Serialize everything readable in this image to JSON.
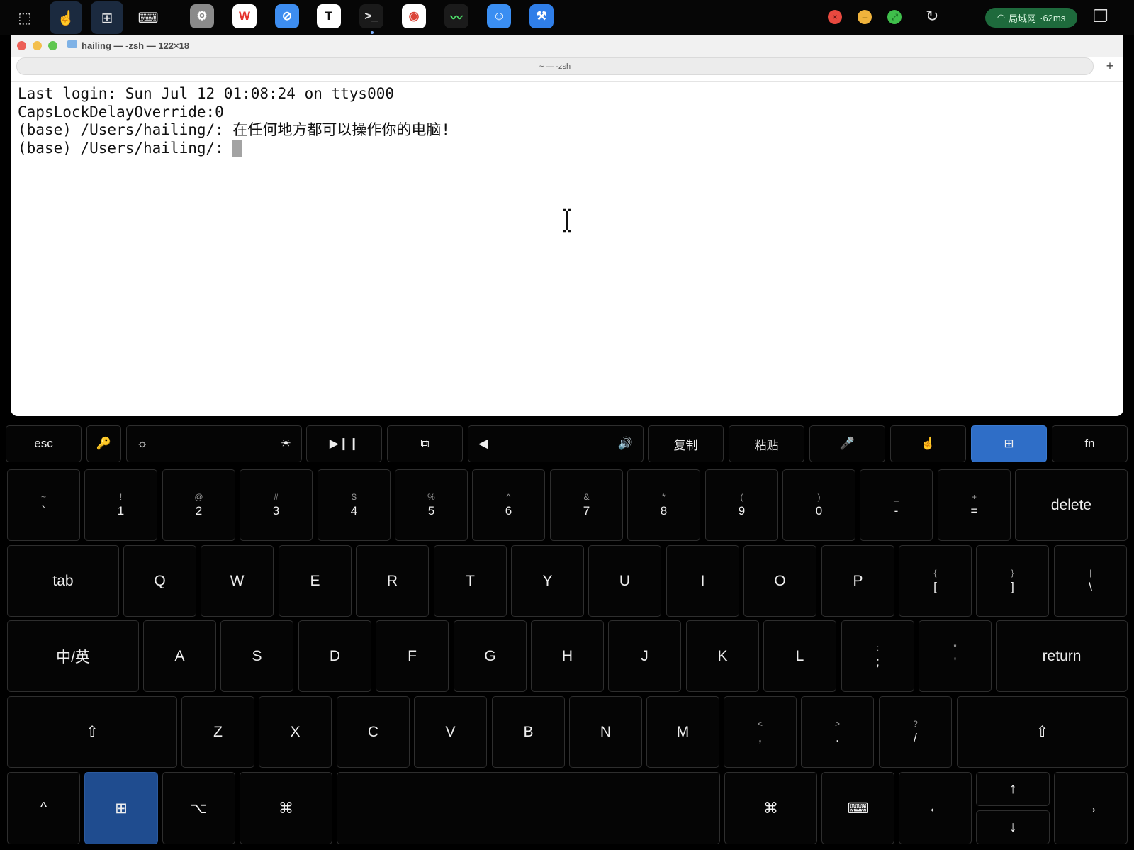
{
  "topbar": {
    "tools": [
      {
        "name": "selection-icon",
        "glyph": "⬚"
      },
      {
        "name": "hand-pointer-icon",
        "glyph": "☝"
      },
      {
        "name": "screen-add-icon",
        "glyph": "⊞"
      },
      {
        "name": "keyboard-icon",
        "glyph": "⌨"
      }
    ],
    "dock": [
      {
        "name": "settings-icon",
        "glyph": "⚙",
        "bg": "#8a8a8a",
        "fg": "#ffffff"
      },
      {
        "name": "wps-icon",
        "glyph": "W",
        "bg": "#ffffff",
        "fg": "#e5322d"
      },
      {
        "name": "safari-icon",
        "glyph": "⊘",
        "bg": "#3d8df0",
        "fg": "#ffffff"
      },
      {
        "name": "typora-icon",
        "glyph": "T",
        "bg": "#ffffff",
        "fg": "#111111"
      },
      {
        "name": "terminal-icon",
        "glyph": ">_",
        "bg": "#1a1a1a",
        "fg": "#e0e0e0"
      },
      {
        "name": "chrome-icon",
        "glyph": "◉",
        "bg": "#ffffff",
        "fg": "#db4437"
      },
      {
        "name": "activity-monitor-icon",
        "glyph": "〰",
        "bg": "#1b1b1b",
        "fg": "#4ee06a"
      },
      {
        "name": "finder-icon",
        "glyph": "☺",
        "bg": "#3a8ef2",
        "fg": "#ffffff"
      },
      {
        "name": "xcode-icon",
        "glyph": "⚒",
        "bg": "#2f7ee8",
        "fg": "#ffffff"
      }
    ],
    "window_controls": [
      {
        "name": "close-dot-icon",
        "glyph": "×",
        "color": "#e8493f"
      },
      {
        "name": "minimize-dot-icon",
        "glyph": "–",
        "color": "#f0b33c"
      },
      {
        "name": "maximize-dot-icon",
        "glyph": "⤢",
        "color": "#3fbf4b"
      }
    ],
    "refresh_glyph": "↻",
    "network": {
      "wifi_glyph": "◠",
      "label": "局域网",
      "latency": "·62ms"
    },
    "windows_glyph": "❐"
  },
  "terminal": {
    "title": "hailing — -zsh — 122×18",
    "tab_label": "~ — -zsh",
    "new_tab": "+",
    "lines": [
      "Last login: Sun Jul 12 01:08:24 on ttys000",
      "CapsLockDelayOverride:0",
      "(base) /Users/hailing/: 在任何地方都可以操作你的电脑!"
    ],
    "prompt": "(base) /Users/hailing/: "
  },
  "keyboard": {
    "fn_row": [
      "esc",
      "🔑",
      "☼",
      "☀",
      "▶❙❙",
      "⧉",
      "◀",
      "🔊",
      "复制",
      "粘贴",
      "🎤",
      "☝",
      "⊞",
      "fn"
    ],
    "num_row": [
      {
        "s": "~",
        "m": "`"
      },
      {
        "s": "!",
        "m": "1"
      },
      {
        "s": "@",
        "m": "2"
      },
      {
        "s": "#",
        "m": "3"
      },
      {
        "s": "$",
        "m": "4"
      },
      {
        "s": "%",
        "m": "5"
      },
      {
        "s": "^",
        "m": "6"
      },
      {
        "s": "&",
        "m": "7"
      },
      {
        "s": "*",
        "m": "8"
      },
      {
        "s": "(",
        "m": "9"
      },
      {
        "s": ")",
        "m": "0"
      },
      {
        "s": "_",
        "m": "-"
      },
      {
        "s": "+",
        "m": "="
      }
    ],
    "delete": "delete",
    "tab": "tab",
    "qwerty": [
      "Q",
      "W",
      "E",
      "R",
      "T",
      "Y",
      "U",
      "I",
      "O",
      "P"
    ],
    "brackets": [
      {
        "s": "{",
        "m": "["
      },
      {
        "s": "}",
        "m": "]"
      },
      {
        "s": "|",
        "m": "\\"
      }
    ],
    "lang": "中/英",
    "asdf": [
      "A",
      "S",
      "D",
      "F",
      "G",
      "H",
      "J",
      "K",
      "L"
    ],
    "semi": [
      {
        "s": ":",
        "m": ";"
      },
      {
        "s": "\"",
        "m": "'"
      }
    ],
    "return": "return",
    "shift_glyph": "⇧",
    "zxcv": [
      "Z",
      "X",
      "C",
      "V",
      "B",
      "N",
      "M"
    ],
    "punct": [
      {
        "s": "<",
        "m": ","
      },
      {
        "s": ">",
        "m": "."
      },
      {
        "s": "?",
        "m": "/"
      }
    ],
    "bottom": {
      "ctrl": "^",
      "screen": "⊞",
      "opt": "⌥",
      "cmd": "⌘",
      "rcmd": "⌘",
      "kbd": "⌨",
      "left": "←",
      "up": "↑",
      "down": "↓",
      "right": "→"
    }
  }
}
